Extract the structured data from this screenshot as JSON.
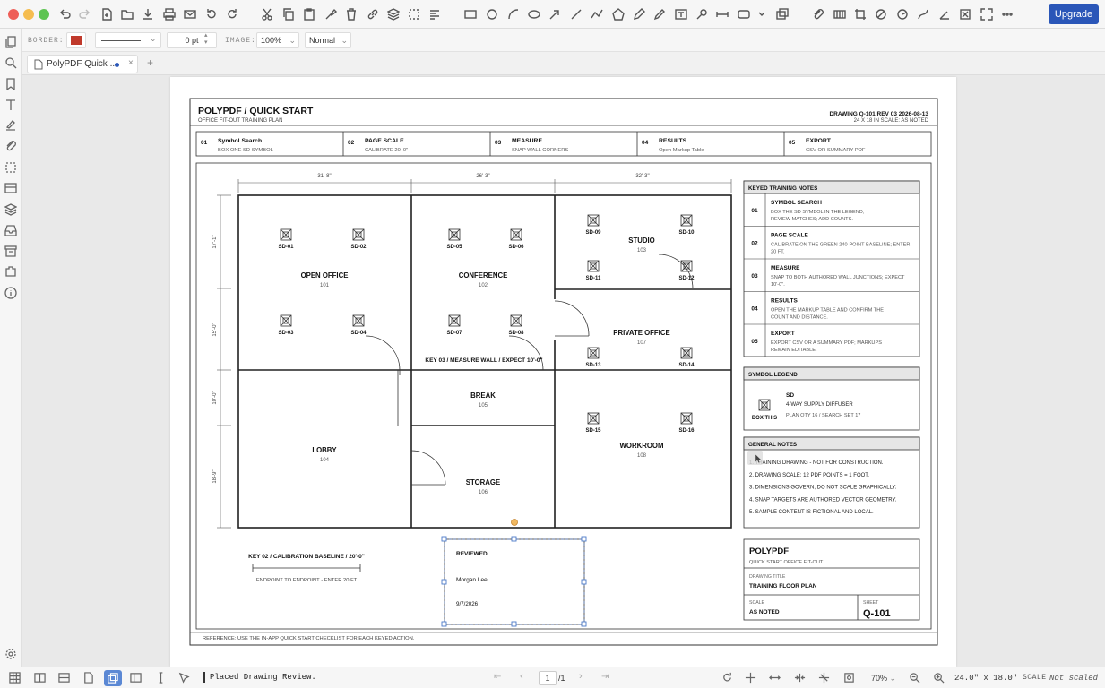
{
  "toolbar": {
    "upgrade_label": "Upgrade",
    "accent": "#2a56b8"
  },
  "props": {
    "border_label": "BORDER:",
    "border_color": "#c0392b",
    "border_width": "0 pt",
    "image_label": "IMAGE:",
    "image_opacity": "100%",
    "blend_mode": "Normal"
  },
  "tab": {
    "title": "PolyPDF Quick ...",
    "add": "+",
    "close": "×"
  },
  "status": {
    "message": "Placed Drawing Review.",
    "page_current": "1",
    "page_total": "/1",
    "zoom": "70%",
    "page_size": "24.0\" x 18.0\"",
    "scale_label": "SCALE",
    "scale_value": "Not scaled"
  },
  "drawing": {
    "title": "POLYPDF / QUICK START",
    "subtitle": "OFFICE FIT-OUT TRAINING PLAN",
    "meta_line1": "DRAWING Q-101    REV 03    2026-08-13",
    "meta_line2": "24 X 18 IN    SCALE: AS NOTED",
    "steps": [
      {
        "num": "01",
        "title": "Symbol Search",
        "sub": "BOX ONE SD SYMBOL"
      },
      {
        "num": "02",
        "title": "PAGE SCALE",
        "sub": "CALIBRATE 20'-0\""
      },
      {
        "num": "03",
        "title": "MEASURE",
        "sub": "SNAP WALL CORNERS"
      },
      {
        "num": "04",
        "title": "RESULTS",
        "sub": "Open Markup Table"
      },
      {
        "num": "05",
        "title": "EXPORT",
        "sub": "CSV OR SUMMARY PDF"
      }
    ],
    "dims_top": [
      "31'-8\"",
      "26'-3\"",
      "32'-3\""
    ],
    "dims_left": [
      "17'-1\"",
      "15'-0\"",
      "10'-0\"",
      "18'-9\""
    ],
    "rooms": [
      {
        "name": "OPEN OFFICE",
        "num": "101"
      },
      {
        "name": "CONFERENCE",
        "num": "102"
      },
      {
        "name": "STUDIO",
        "num": "103"
      },
      {
        "name": "LOBBY",
        "num": "104"
      },
      {
        "name": "BREAK",
        "num": "105"
      },
      {
        "name": "STORAGE",
        "num": "106"
      },
      {
        "name": "PRIVATE OFFICE",
        "num": "107"
      },
      {
        "name": "WORKROOM",
        "num": "108"
      }
    ],
    "diffusers": [
      "SD-01",
      "SD-02",
      "SD-03",
      "SD-04",
      "SD-05",
      "SD-06",
      "SD-07",
      "SD-08",
      "SD-09",
      "SD-10",
      "SD-11",
      "SD-12",
      "SD-13",
      "SD-14",
      "SD-15",
      "SD-16"
    ],
    "key03": "KEY 03 / MEASURE WALL / EXPECT 10'-0\"",
    "key02": "KEY 02 / CALIBRATION BASELINE / 20'-0\"",
    "key02_sub": "ENDPOINT TO ENDPOINT - ENTER 20 FT",
    "stamp": {
      "title": "REVIEWED",
      "name": "Morgan Lee",
      "date": "9/7/2026"
    },
    "notes_header": "KEYED TRAINING NOTES",
    "notes": [
      {
        "num": "01",
        "title": "SYMBOL SEARCH",
        "l1": "BOX THE SD SYMBOL IN THE LEGEND;",
        "l2": "REVIEW MATCHES; ADD COUNTS."
      },
      {
        "num": "02",
        "title": "PAGE SCALE",
        "l1": "CALIBRATE ON THE GREEN 240-POINT BASELINE; ENTER",
        "l2": "20 FT."
      },
      {
        "num": "03",
        "title": "MEASURE",
        "l1": "SNAP TO BOTH AUTHORED WALL JUNCTIONS; EXPECT",
        "l2": "10'-0\"."
      },
      {
        "num": "04",
        "title": "RESULTS",
        "l1": "OPEN THE MARKUP TABLE AND CONFIRM THE",
        "l2": "COUNT AND DISTANCE."
      },
      {
        "num": "05",
        "title": "EXPORT",
        "l1": "EXPORT CSV OR A SUMMARY PDF; MARKUPS",
        "l2": "REMAIN EDITABLE."
      }
    ],
    "legend_header": "SYMBOL LEGEND",
    "legend": {
      "box": "BOX THIS",
      "code": "SD",
      "desc": "4-WAY SUPPLY DIFFUSER",
      "qty": "PLAN QTY 16 / SEARCH SET 17"
    },
    "general_header": "GENERAL NOTES",
    "general": [
      "1. TRAINING DRAWING - NOT FOR CONSTRUCTION.",
      "2. DRAWING SCALE: 12 PDF POINTS = 1 FOOT.",
      "3. DIMENSIONS GOVERN; DO NOT SCALE GRAPHICALLY.",
      "4. SNAP TARGETS ARE AUTHORED VECTOR GEOMETRY.",
      "5. SAMPLE CONTENT IS FICTIONAL AND LOCAL."
    ],
    "titleblock": {
      "company": "POLYPDF",
      "project": "QUICK START OFFICE FIT-OUT",
      "dt_label": "DRAWING TITLE",
      "dt_value": "TRAINING FLOOR PLAN",
      "scale_label": "SCALE",
      "scale_value": "AS NOTED",
      "sheet_label": "SHEET",
      "sheet_value": "Q-101"
    },
    "reference": "REFERENCE: USE THE IN-APP QUICK START CHECKLIST FOR EACH KEYED ACTION."
  }
}
